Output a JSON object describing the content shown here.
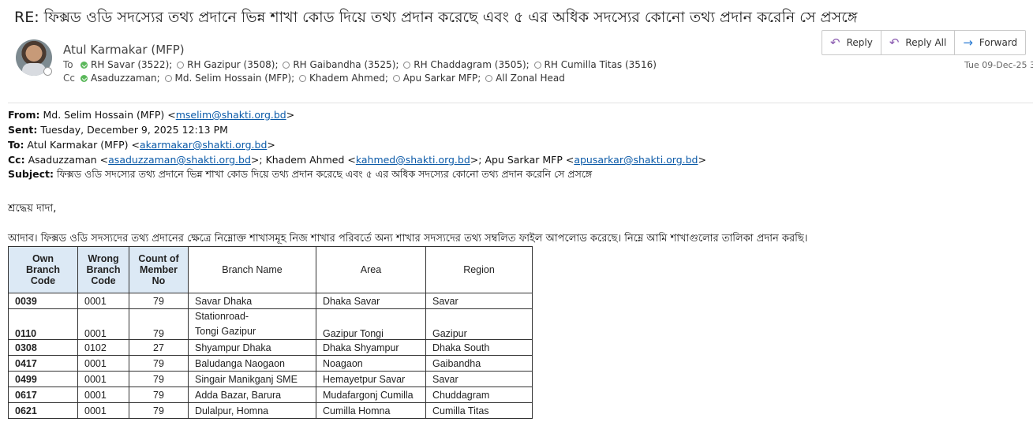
{
  "email": {
    "subject": "RE: ফিক্সড ওডি সদস্যের তথ্য প্রদানে ভিন্ন শাখা কোড দিয়ে তথ্য প্রদান করেছে এবং ৫ এর অধিক সদস্যের কোনো তথ্য প্রদান করেনি সে প্রসঙ্গে",
    "sender": "Atul  Karmakar (MFP)",
    "to_label": "To",
    "cc_label": "Cc",
    "to": [
      {
        "name": "RH Savar (3522);",
        "status": "available"
      },
      {
        "name": "RH Gazipur (3508);",
        "status": "offline"
      },
      {
        "name": "RH Gaibandha (3525);",
        "status": "offline"
      },
      {
        "name": "RH Chaddagram (3505);",
        "status": "offline"
      },
      {
        "name": "RH Cumilla Titas (3516)",
        "status": "offline"
      }
    ],
    "cc": [
      {
        "name": "Asaduzzaman;",
        "status": "available"
      },
      {
        "name": "Md. Selim Hossain (MFP);",
        "status": "offline"
      },
      {
        "name": "Khadem Ahmed;",
        "status": "offline"
      },
      {
        "name": "Apu Sarkar MFP;",
        "status": "offline"
      },
      {
        "name": "All Zonal Head",
        "status": "offline"
      }
    ],
    "date": "Tue 09-Dec-25 3:"
  },
  "actions": {
    "reply": "Reply",
    "reply_all": "Reply All",
    "forward": "Forward",
    "reply_icon": "reply-arrow-icon",
    "reply_all_icon": "reply-all-arrow-icon",
    "forward_icon": "forward-arrow-icon"
  },
  "quoted": {
    "from_label": "From:",
    "from_name": " Md. Selim Hossain (MFP) <",
    "from_email": "mselim@shakti.org.bd",
    "sent_label": "Sent:",
    "sent_value": " Tuesday, December 9, 2025 12:13 PM",
    "to_label": "To:",
    "to_name": " Atul Karmakar (MFP) <",
    "to_email": "akarmakar@shakti.org.bd",
    "cc_label": "Cc:",
    "cc_1_name": " Asaduzzaman <",
    "cc_1_email": "asaduzzaman@shakti.org.bd",
    "cc_2_name": ">; Khadem Ahmed <",
    "cc_2_email": "kahmed@shakti.org.bd",
    "cc_3_name": ">; Apu Sarkar MFP <",
    "cc_3_email": "apusarkar@shakti.org.bd",
    "subject_label": "Subject:",
    "subject_value": " ফিক্সড ওডি সদস্যের তথ্য প্রদানে ভিন্ন শাখা কোড দিয়ে তথ্য প্রদান করেছে এবং ৫ এর অধিক সদস্যের কোনো তথ্য প্রদান করেনি সে প্রসঙ্গে",
    "close_bracket": ">"
  },
  "body": {
    "greeting": "শ্রদ্ধেয় দাদা,",
    "paragraph": "আদাব। ফিক্সড ওডি সদস্যদের তথ্য প্রদানের ক্ষেত্রে নিম্নোক্ত শাখাসমূহ নিজ শাখার পরিবর্তে অন্য শাখার সদস্যদের তথ্য সম্বলিত ফাইল আপলোড করেছে। নিম্নে আমি শাখাগুলোর তালিকা প্রদান করছি।"
  },
  "table": {
    "headers": {
      "own": [
        "Own",
        "Branch",
        "Code"
      ],
      "wrong": [
        "Wrong",
        "Branch",
        "Code"
      ],
      "count": [
        "Count of",
        "Member",
        "No"
      ],
      "branch": "Branch Name",
      "area": "Area",
      "region": "Region"
    },
    "rows": [
      {
        "own": "0039",
        "wrong": "0001",
        "count": "79",
        "branch_1": "Savar  Dhaka",
        "branch_2": "",
        "area": "Dhaka Savar",
        "region": "Savar"
      },
      {
        "own": "0110",
        "wrong": "0001",
        "count": "79",
        "branch_1": "Stationroad-",
        "branch_2": "Tongi  Gazipur",
        "area": "Gazipur Tongi",
        "region": "Gazipur"
      },
      {
        "own": "0308",
        "wrong": "0102",
        "count": "27",
        "branch_1": "Shyampur Dhaka",
        "branch_2": "",
        "area": "Dhaka Shyampur",
        "region": "Dhaka South"
      },
      {
        "own": "0417",
        "wrong": "0001",
        "count": "79",
        "branch_1": "Baludanga Naogaon",
        "branch_2": "",
        "area": "Noagaon",
        "region": "Gaibandha"
      },
      {
        "own": "0499",
        "wrong": "0001",
        "count": "79",
        "branch_1": "Singair Manikganj SME",
        "branch_2": "",
        "area": "Hemayetpur Savar",
        "region": "Savar"
      },
      {
        "own": "0617",
        "wrong": "0001",
        "count": "79",
        "branch_1": "Adda Bazar, Barura",
        "branch_2": "",
        "area": "Mudafargonj Cumilla",
        "region": "Chuddagram"
      },
      {
        "own": "0621",
        "wrong": "0001",
        "count": "79",
        "branch_1": "Dulalpur, Homna",
        "branch_2": "",
        "area": "Cumilla Homna",
        "region": "Cumilla Titas"
      }
    ]
  },
  "colors": {
    "link": "#0b5aa8",
    "available": "#5bb85b",
    "header_fill": "#dce9f5",
    "reply_icon": "#8a5ab0",
    "forward_icon": "#2b7cd3"
  }
}
